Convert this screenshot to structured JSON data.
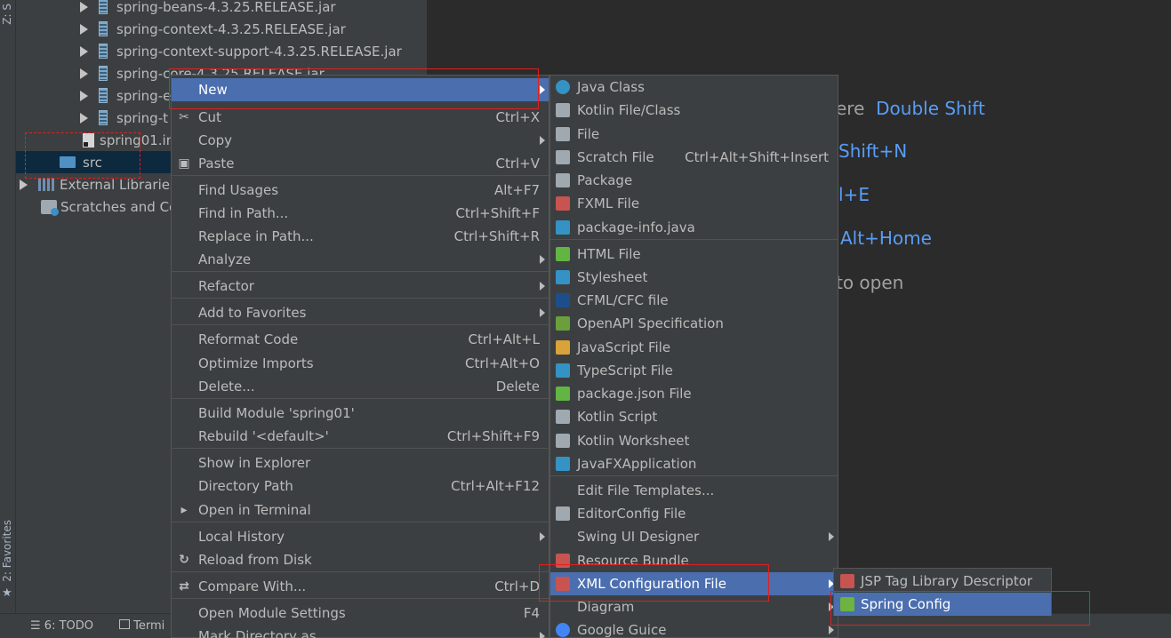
{
  "left_stripe": {
    "top_label": "Z: S",
    "bottom_label": "2: Favorites"
  },
  "project_tree": [
    {
      "label": "spring-beans-4.3.25.RELEASE.jar",
      "type": "jar"
    },
    {
      "label": "spring-context-4.3.25.RELEASE.jar",
      "type": "jar"
    },
    {
      "label": "spring-context-support-4.3.25.RELEASE.jar",
      "type": "jar"
    },
    {
      "label": "spring-core-4.3.25.RELEASE.jar",
      "type": "jar"
    },
    {
      "label": "spring-e",
      "type": "jar"
    },
    {
      "label": "spring-t",
      "type": "jar"
    },
    {
      "label": "spring01.im",
      "type": "file"
    },
    {
      "label": "src",
      "type": "folder"
    },
    {
      "label": "External Libraries",
      "type": "library"
    },
    {
      "label": "Scratches and Co",
      "type": "scratch"
    }
  ],
  "editor_hints": [
    {
      "text": "ere",
      "key": "Double Shift"
    },
    {
      "text": "",
      "key": "Shift+N"
    },
    {
      "text": "",
      "key": "l+E"
    },
    {
      "text": "",
      "key": "Alt+Home"
    },
    {
      "text": "to open",
      "key": ""
    }
  ],
  "bottom_bar": {
    "todo": "6: TODO",
    "terminal": "Termi"
  },
  "context_menu": [
    {
      "label": "New",
      "shortcut": "",
      "submenu": true,
      "highlighted": true,
      "icon": ""
    },
    {
      "label": "Cut",
      "shortcut": "Ctrl+X",
      "submenu": false,
      "icon": "scissors-icon"
    },
    {
      "label": "Copy",
      "shortcut": "",
      "submenu": true,
      "icon": ""
    },
    {
      "label": "Paste",
      "shortcut": "Ctrl+V",
      "submenu": false,
      "icon": "clipboard-icon"
    },
    {
      "label": "Find Usages",
      "shortcut": "Alt+F7",
      "submenu": false,
      "icon": ""
    },
    {
      "label": "Find in Path...",
      "shortcut": "Ctrl+Shift+F",
      "submenu": false,
      "icon": ""
    },
    {
      "label": "Replace in Path...",
      "shortcut": "Ctrl+Shift+R",
      "submenu": false,
      "icon": ""
    },
    {
      "label": "Analyze",
      "shortcut": "",
      "submenu": true,
      "icon": ""
    },
    {
      "label": "Refactor",
      "shortcut": "",
      "submenu": true,
      "icon": ""
    },
    {
      "label": "Add to Favorites",
      "shortcut": "",
      "submenu": true,
      "icon": ""
    },
    {
      "label": "Reformat Code",
      "shortcut": "Ctrl+Alt+L",
      "submenu": false,
      "icon": ""
    },
    {
      "label": "Optimize Imports",
      "shortcut": "Ctrl+Alt+O",
      "submenu": false,
      "icon": ""
    },
    {
      "label": "Delete...",
      "shortcut": "Delete",
      "submenu": false,
      "icon": ""
    },
    {
      "label": "Build Module 'spring01'",
      "shortcut": "",
      "submenu": false,
      "icon": ""
    },
    {
      "label": "Rebuild '<default>'",
      "shortcut": "Ctrl+Shift+F9",
      "submenu": false,
      "icon": ""
    },
    {
      "label": "Show in Explorer",
      "shortcut": "",
      "submenu": false,
      "icon": ""
    },
    {
      "label": "Directory Path",
      "shortcut": "Ctrl+Alt+F12",
      "submenu": false,
      "icon": ""
    },
    {
      "label": "Open in Terminal",
      "shortcut": "",
      "submenu": false,
      "icon": "terminal-icon"
    },
    {
      "label": "Local History",
      "shortcut": "",
      "submenu": true,
      "icon": ""
    },
    {
      "label": "Reload from Disk",
      "shortcut": "",
      "submenu": false,
      "icon": "reload-icon"
    },
    {
      "label": "Compare With...",
      "shortcut": "Ctrl+D",
      "submenu": false,
      "icon": "compare-icon"
    },
    {
      "label": "Open Module Settings",
      "shortcut": "F4",
      "submenu": false,
      "icon": ""
    },
    {
      "label": "Mark Directory as",
      "shortcut": "",
      "submenu": true,
      "icon": ""
    }
  ],
  "new_menu": [
    {
      "label": "Java Class",
      "shortcut": "",
      "submenu": false,
      "icon": "java-class-icon",
      "color": "#3592c4"
    },
    {
      "label": "Kotlin File/Class",
      "shortcut": "",
      "submenu": false,
      "icon": "kotlin-file-icon",
      "color": "#a0a8b0"
    },
    {
      "label": "File",
      "shortcut": "",
      "submenu": false,
      "icon": "file-icon",
      "color": "#a0a8b0"
    },
    {
      "label": "Scratch File",
      "shortcut": "Ctrl+Alt+Shift+Insert",
      "submenu": false,
      "icon": "scratch-file-icon",
      "color": "#a0a8b0"
    },
    {
      "label": "Package",
      "shortcut": "",
      "submenu": false,
      "icon": "package-icon",
      "color": "#a0a8b0"
    },
    {
      "label": "FXML File",
      "shortcut": "",
      "submenu": false,
      "icon": "fxml-file-icon",
      "color": "#c75450"
    },
    {
      "label": "package-info.java",
      "shortcut": "",
      "submenu": false,
      "icon": "package-info-icon",
      "color": "#3592c4"
    },
    {
      "label": "HTML File",
      "shortcut": "",
      "submenu": false,
      "icon": "html-file-icon",
      "color": "#62b543"
    },
    {
      "label": "Stylesheet",
      "shortcut": "",
      "submenu": false,
      "icon": "stylesheet-icon",
      "color": "#3592c4"
    },
    {
      "label": "CFML/CFC file",
      "shortcut": "",
      "submenu": false,
      "icon": "cfml-icon",
      "color": "#1c4e8c"
    },
    {
      "label": "OpenAPI Specification",
      "shortcut": "",
      "submenu": false,
      "icon": "openapi-icon",
      "color": "#6a9f3c"
    },
    {
      "label": "JavaScript File",
      "shortcut": "",
      "submenu": false,
      "icon": "javascript-file-icon",
      "color": "#d9a33a"
    },
    {
      "label": "TypeScript File",
      "shortcut": "",
      "submenu": false,
      "icon": "typescript-file-icon",
      "color": "#3592c4"
    },
    {
      "label": "package.json File",
      "shortcut": "",
      "submenu": false,
      "icon": "package-json-icon",
      "color": "#62b543"
    },
    {
      "label": "Kotlin Script",
      "shortcut": "",
      "submenu": false,
      "icon": "kotlin-script-icon",
      "color": "#a0a8b0"
    },
    {
      "label": "Kotlin Worksheet",
      "shortcut": "",
      "submenu": false,
      "icon": "kotlin-worksheet-icon",
      "color": "#a0a8b0"
    },
    {
      "label": "JavaFXApplication",
      "shortcut": "",
      "submenu": false,
      "icon": "javafx-icon",
      "color": "#3592c4"
    },
    {
      "label": "Edit File Templates...",
      "shortcut": "",
      "submenu": false,
      "icon": ""
    },
    {
      "label": "EditorConfig File",
      "shortcut": "",
      "submenu": false,
      "icon": "gear-icon",
      "color": "#a0a8b0"
    },
    {
      "label": "Swing UI Designer",
      "shortcut": "",
      "submenu": true,
      "icon": ""
    },
    {
      "label": "Resource Bundle",
      "shortcut": "",
      "submenu": false,
      "icon": "resource-bundle-icon",
      "color": "#c75450"
    },
    {
      "label": "XML Configuration File",
      "shortcut": "",
      "submenu": true,
      "highlighted": true,
      "icon": "xml-config-icon",
      "color": "#c75450"
    },
    {
      "label": "Diagram",
      "shortcut": "",
      "submenu": true,
      "icon": ""
    },
    {
      "label": "Google Guice",
      "shortcut": "",
      "submenu": true,
      "icon": "google-icon",
      "color": "#4285f4"
    }
  ],
  "xml_menu": [
    {
      "label": "JSP Tag Library Descriptor",
      "icon": "jsp-tld-icon",
      "color": "#c75450"
    },
    {
      "label": "Spring Config",
      "icon": "spring-config-icon",
      "color": "#6db33f",
      "highlighted": true
    }
  ]
}
